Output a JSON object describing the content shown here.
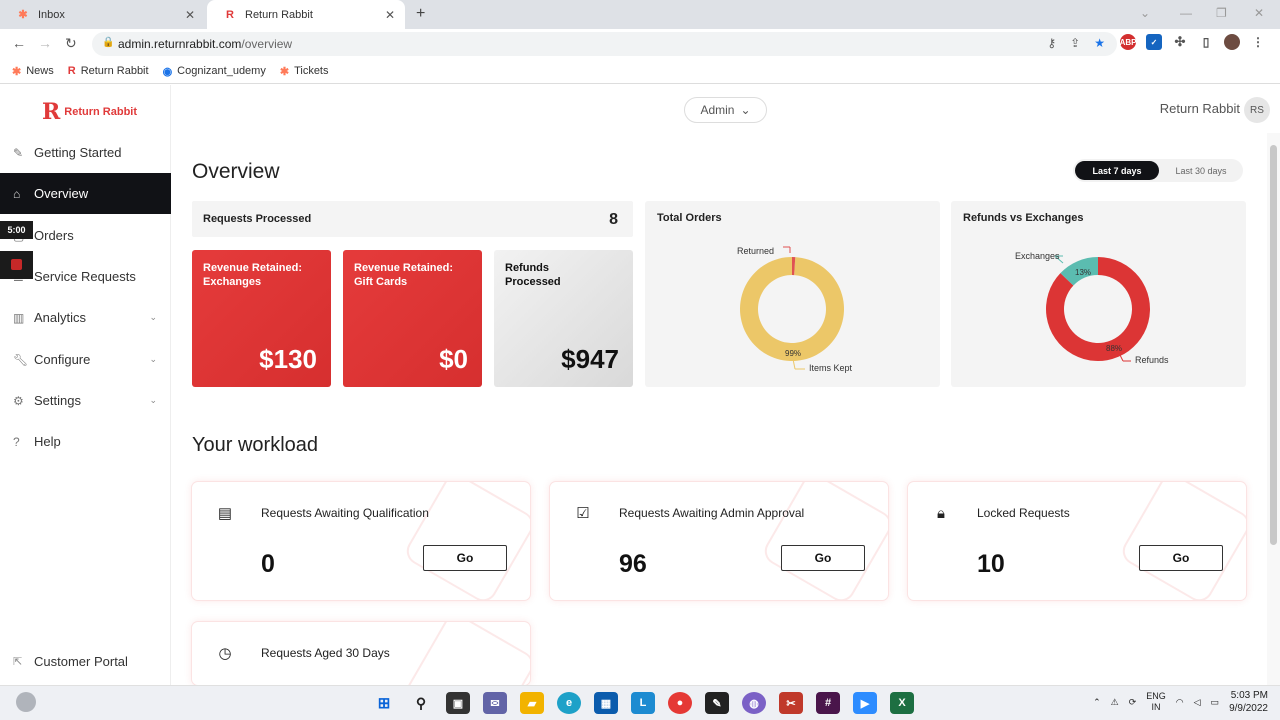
{
  "browser": {
    "tabs": [
      {
        "label": "Inbox",
        "icon": "hubspot-icon"
      },
      {
        "label": "Return Rabbit",
        "icon": "return-rabbit-icon"
      }
    ],
    "url_host": "admin.returnrabbit.com",
    "url_path": "/overview",
    "bookmarks": [
      {
        "label": "News",
        "icon": "hubspot-icon"
      },
      {
        "label": "Return Rabbit",
        "icon": "return-rabbit-icon"
      },
      {
        "label": "Cognizant_udemy",
        "icon": "edge-icon"
      },
      {
        "label": "Tickets",
        "icon": "hubspot-icon"
      }
    ],
    "ext_abp": "ABP"
  },
  "app": {
    "logo_text": "Return Rabbit",
    "logo_mark": "R",
    "role": "Admin",
    "user_name": "Return Rabbit",
    "user_initials": "RS"
  },
  "sidebar": {
    "items": [
      {
        "label": "Getting Started",
        "icon": "pencil-icon"
      },
      {
        "label": "Overview",
        "icon": "home-icon",
        "active": true
      },
      {
        "label": "Orders",
        "icon": "box-icon"
      },
      {
        "label": "Service Requests",
        "icon": "list-icon"
      },
      {
        "label": "Analytics",
        "icon": "chart-icon",
        "chevron": true
      },
      {
        "label": "Configure",
        "icon": "wrench-icon",
        "chevron": true
      },
      {
        "label": "Settings",
        "icon": "gear-icon",
        "chevron": true
      },
      {
        "label": "Help",
        "icon": "help-icon"
      }
    ],
    "footer": "Customer Portal",
    "timer": "5:00"
  },
  "overview": {
    "title": "Overview",
    "range_options": [
      "Last 7 days",
      "Last 30 days"
    ],
    "range_selected": "Last 7 days",
    "requests_processed_label": "Requests Processed",
    "requests_processed_value": "8",
    "cards": [
      {
        "title": "Revenue Retained: Exchanges",
        "value": "$130",
        "style": "red"
      },
      {
        "title": "Revenue Retained: Gift Cards",
        "value": "$0",
        "style": "red"
      },
      {
        "title": "Refunds Processed",
        "value": "$947",
        "style": "grey"
      }
    ],
    "total_orders": {
      "title": "Total Orders",
      "segments": [
        {
          "label": "Returned",
          "percent": 1,
          "color": "#e05252"
        },
        {
          "label": "Items Kept",
          "percent": 99,
          "color": "#ecc768"
        }
      ],
      "pct_kept": "99%"
    },
    "refunds_vs_exchanges": {
      "title": "Refunds vs Exchanges",
      "segments": [
        {
          "label": "Exchanges",
          "percent": 13,
          "color": "#5bbcb0"
        },
        {
          "label": "Refunds",
          "percent": 88,
          "color": "#dc3535"
        }
      ],
      "pct_exchanges": "13%",
      "pct_refunds": "88%"
    }
  },
  "workload": {
    "title": "Your workload",
    "cards": [
      {
        "title": "Requests Awaiting Qualification",
        "value": "0",
        "button": "Go",
        "icon": "document-icon"
      },
      {
        "title": "Requests Awaiting Admin Approval",
        "value": "96",
        "button": "Go",
        "icon": "checkbox-icon"
      },
      {
        "title": "Locked Requests",
        "value": "10",
        "button": "Go",
        "icon": "lock-icon"
      },
      {
        "title": "Requests Aged 30 Days",
        "value": "",
        "button": "",
        "icon": "clock-icon"
      }
    ]
  },
  "taskbar": {
    "lang_line1": "ENG",
    "lang_line2": "IN",
    "time": "5:03 PM",
    "date": "9/9/2022"
  },
  "colors": {
    "accent_red": "#e03a3a",
    "nav_active_bg": "#111216"
  }
}
